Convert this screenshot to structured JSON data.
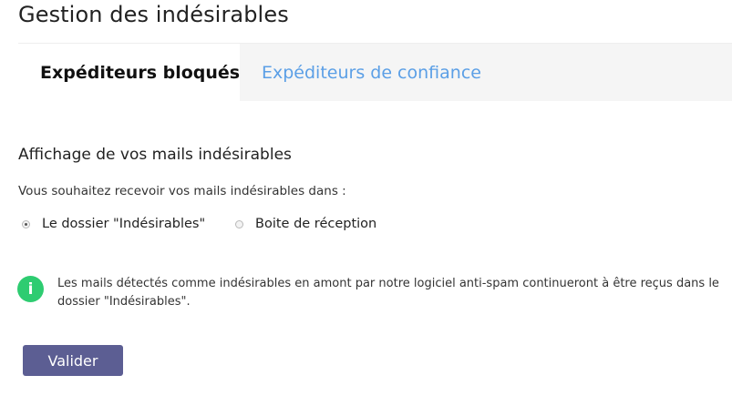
{
  "page": {
    "title": "Gestion des indésirables"
  },
  "tabs": [
    {
      "label": "Expéditeurs bloqués",
      "active": true
    },
    {
      "label": "Expéditeurs de confiance",
      "active": false
    }
  ],
  "section": {
    "title": "Affichage de vos mails indésirables",
    "description": "Vous souhaitez recevoir vos mails indésirables dans :"
  },
  "options": [
    {
      "label": "Le dossier \"Indésirables\"",
      "checked": true
    },
    {
      "label": "Boite de réception",
      "checked": false
    }
  ],
  "info": {
    "icon": "info-icon",
    "icon_glyph": "i",
    "text": "Les mails détectés comme indésirables en amont par notre logiciel anti-spam continueront à être reçus dans le dossier \"Indésirables\"."
  },
  "actions": {
    "submit_label": "Valider"
  },
  "colors": {
    "tab_inactive_text": "#5b9fe6",
    "info_icon_bg": "#2ecc71",
    "button_bg": "#5c5e93"
  }
}
